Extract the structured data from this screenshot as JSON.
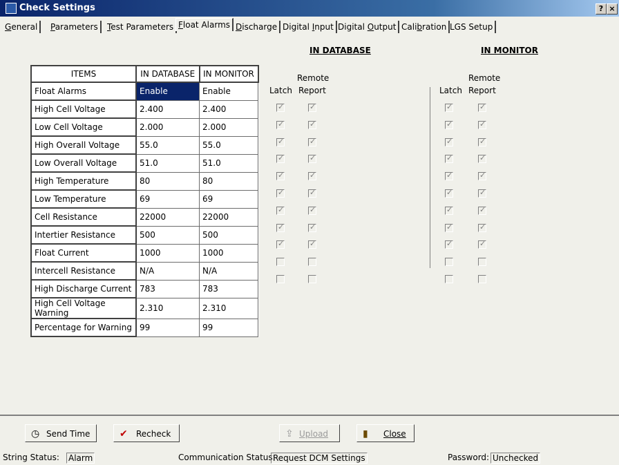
{
  "window": {
    "title": "Check Settings",
    "help_label": "?",
    "close_label": "×"
  },
  "tabs": [
    {
      "label": "General",
      "accel": "G",
      "rest": "eneral"
    },
    {
      "label": "Parameters",
      "accel": "P",
      "rest": "arameters"
    },
    {
      "label": "Test Parameters",
      "accel": "T",
      "rest": "est Parameters"
    },
    {
      "label": "Float Alarms",
      "accel": "F",
      "rest": "loat Alarms"
    },
    {
      "label": "Discharge",
      "accel": "D",
      "rest": "ischarge"
    },
    {
      "label": "Digital Input",
      "pre": "Digital ",
      "accel": "I",
      "rest": "nput"
    },
    {
      "label": "Digital Output",
      "pre": "Digital ",
      "accel": "O",
      "rest": "utput"
    },
    {
      "label": "Calibration",
      "pre": "Cali",
      "accel": "b",
      "rest": "ration"
    },
    {
      "label": "LGS Setup",
      "pre": "",
      "accel": "",
      "rest": "LGS Setup"
    }
  ],
  "headers": {
    "in_database": "IN DATABASE",
    "in_monitor": "IN MONITOR"
  },
  "table": {
    "columns": [
      "ITEMS",
      "IN DATABASE",
      "IN MONITOR"
    ],
    "rows": [
      {
        "item": "Float Alarms",
        "db": "Enable",
        "mon": "Enable"
      },
      {
        "item": "High Cell Voltage",
        "db": " 2.400",
        "mon": " 2.400"
      },
      {
        "item": "Low Cell Voltage",
        "db": " 2.000",
        "mon": " 2.000"
      },
      {
        "item": "High Overall Voltage",
        "db": "55.0",
        "mon": "55.0"
      },
      {
        "item": "Low Overall Voltage",
        "db": "51.0",
        "mon": "51.0"
      },
      {
        "item": "High Temperature",
        "db": "80",
        "mon": "80"
      },
      {
        "item": "Low Temperature",
        "db": "69",
        "mon": "69"
      },
      {
        "item": "Cell Resistance",
        "db": "22000",
        "mon": "22000"
      },
      {
        "item": "Intertier Resistance",
        "db": "500",
        "mon": "500"
      },
      {
        "item": "Float Current",
        "db": "1000",
        "mon": "1000"
      },
      {
        "item": "Intercell Resistance",
        "db": "N/A",
        "mon": "N/A"
      },
      {
        "item": "High Discharge Current",
        "db": "783",
        "mon": "783"
      },
      {
        "item": "High Cell Voltage Warning",
        "db": " 2.310",
        "mon": " 2.310"
      },
      {
        "item": "Percentage for Warning",
        "db": "99",
        "mon": "99"
      }
    ]
  },
  "checkbox_headers": {
    "remote": "Remote",
    "latch": "Latch",
    "report": "Report"
  },
  "db_checks": [
    [
      true,
      true
    ],
    [
      true,
      true
    ],
    [
      true,
      true
    ],
    [
      true,
      true
    ],
    [
      true,
      true
    ],
    [
      true,
      true
    ],
    [
      true,
      true
    ],
    [
      true,
      true
    ],
    [
      true,
      true
    ],
    [
      false,
      false
    ],
    [
      false,
      false
    ]
  ],
  "monitor_checks": [
    [
      true,
      true
    ],
    [
      true,
      true
    ],
    [
      true,
      true
    ],
    [
      true,
      true
    ],
    [
      true,
      true
    ],
    [
      true,
      true
    ],
    [
      true,
      true
    ],
    [
      true,
      true
    ],
    [
      true,
      true
    ],
    [
      false,
      false
    ],
    [
      false,
      false
    ]
  ],
  "buttons": {
    "send_time": "Send Time",
    "recheck": "Recheck",
    "upload": "Upload",
    "close": "Close"
  },
  "status": {
    "string_label": "String Status:",
    "string_value": "Alarm",
    "comm_label": "Communication Status:",
    "comm_value": "Request DCM Settings",
    "password_label": "Password:",
    "password_value": "Unchecked"
  }
}
